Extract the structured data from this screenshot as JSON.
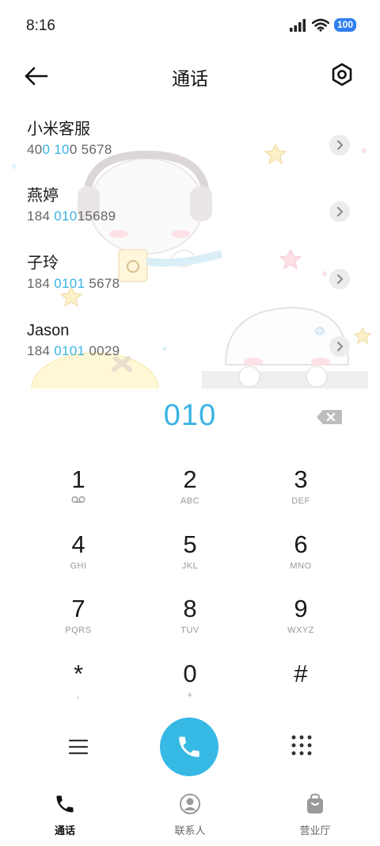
{
  "status": {
    "time": "8:16",
    "battery": "100"
  },
  "header": {
    "title": "通话"
  },
  "contacts": [
    {
      "name": "小米客服",
      "number": [
        "40",
        "0 10",
        "0 5678"
      ]
    },
    {
      "name": "燕婷",
      "number": [
        "184 ",
        "010",
        "15689"
      ]
    },
    {
      "name": "子玲",
      "number": [
        "184 ",
        "0101",
        " 5678"
      ]
    },
    {
      "name": "Jason",
      "number": [
        "184 ",
        "0101",
        " 0029"
      ]
    }
  ],
  "dialer": {
    "input": "010"
  },
  "keypad": [
    {
      "digit": "1",
      "sub": ""
    },
    {
      "digit": "2",
      "sub": "ABC"
    },
    {
      "digit": "3",
      "sub": "DEF"
    },
    {
      "digit": "4",
      "sub": "GHI"
    },
    {
      "digit": "5",
      "sub": "JKL"
    },
    {
      "digit": "6",
      "sub": "MNO"
    },
    {
      "digit": "7",
      "sub": "PQRS"
    },
    {
      "digit": "8",
      "sub": "TUV"
    },
    {
      "digit": "9",
      "sub": "WXYZ"
    },
    {
      "digit": "*",
      "sub": ","
    },
    {
      "digit": "0",
      "sub": "+"
    },
    {
      "digit": "#",
      "sub": ""
    }
  ],
  "nav": [
    {
      "label": "通话",
      "icon": "phone-icon",
      "active": true
    },
    {
      "label": "联系人",
      "icon": "contacts-icon",
      "active": false
    },
    {
      "label": "营业厅",
      "icon": "shop-bag-icon",
      "active": false
    }
  ],
  "colors": {
    "accent": "#39b3e4",
    "call_button": "#37b9e5",
    "battery": "#2f7ff0"
  }
}
